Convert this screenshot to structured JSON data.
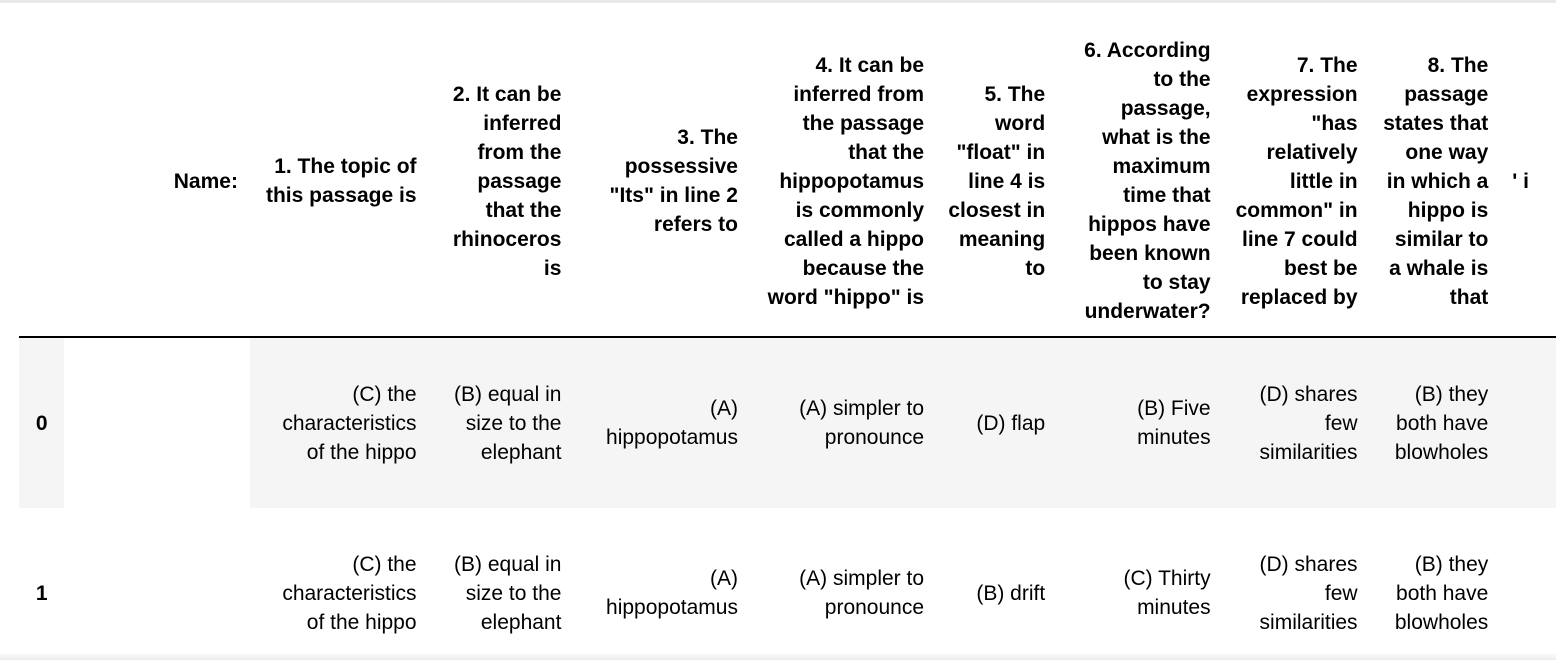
{
  "table": {
    "columns": [
      "",
      "Name:",
      "1. The topic of this passage is",
      "2. It can be inferred from the passage that the rhinoceros is",
      "3. The possessive \"Its\" in line 2 refers to",
      "4. It can be inferred from the passage that the hippopotamus is commonly called a hippo because the word \"hippo\" is",
      "5. The word \"float\" in line 4 is closest in meaning to",
      "6. According to the passage, what is the maximum time that hippos have been known to stay underwater?",
      "7. The expression \"has relatively little in common\" in line 7 could best be replaced by",
      "8. The passage states that one way in which a hippo is similar to a whale is that",
      "' i"
    ],
    "rows": [
      {
        "index": "0",
        "name": "",
        "cells": [
          "(C) the characteristics of the hippo",
          "(B) equal in size to the elephant",
          "(A) hippopotamus",
          "(A) simpler to pronounce",
          "(D) flap",
          "(B) Five minutes",
          "(D) shares few similarities",
          "(B) they both have blowholes",
          ""
        ]
      },
      {
        "index": "1",
        "name": "",
        "cells": [
          "(C) the characteristics of the hippo",
          "(B) equal in size to the elephant",
          "(A) hippopotamus",
          "(A) simpler to pronounce",
          "(B) drift",
          "(C) Thirty minutes",
          "(D) shares few similarities",
          "(B) they both have blowholes",
          ""
        ]
      }
    ]
  }
}
